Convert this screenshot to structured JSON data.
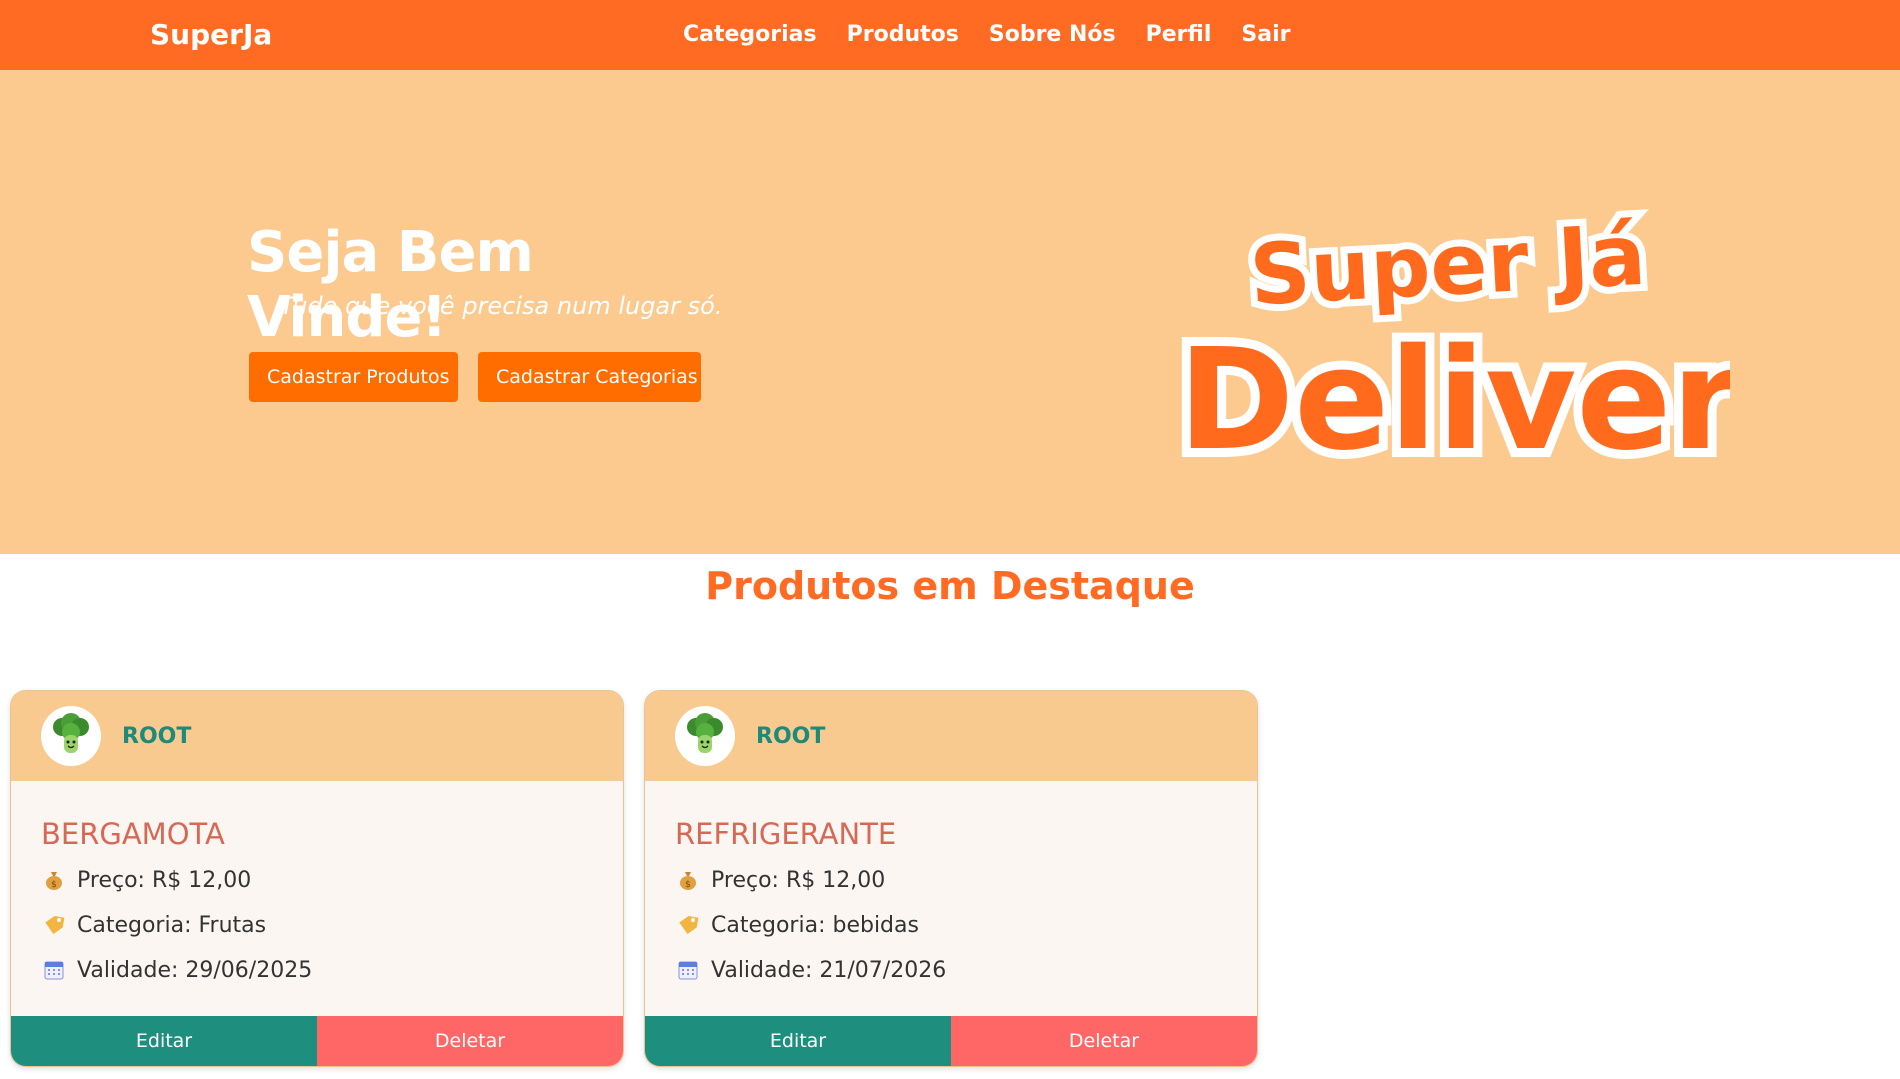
{
  "navbar": {
    "brand": "SuperJa",
    "links": [
      "Categorias",
      "Produtos",
      "Sobre Nós",
      "Perfil",
      "Sair"
    ]
  },
  "hero": {
    "title": "Seja Bem Vinde!",
    "subtitle": "Tudo que você precisa num lugar só.",
    "btn_produtos": "Cadastrar Produtos",
    "btn_categorias": "Cadastrar Categorias",
    "logo_line1": "Super Já",
    "logo_line2": "Delivery"
  },
  "section": {
    "title": "Produtos em Destaque"
  },
  "products": [
    {
      "owner": "ROOT",
      "name": "BERGAMOTA",
      "price": "Preço: R$ 12,00",
      "category": "Categoria: Frutas",
      "validity": "Validade: 29/06/2025",
      "edit_label": "Editar",
      "delete_label": "Deletar"
    },
    {
      "owner": "ROOT",
      "name": "REFRIGERANTE",
      "price": "Preço: R$ 12,00",
      "category": "Categoria: bebidas",
      "validity": "Validade: 21/07/2026",
      "edit_label": "Editar",
      "delete_label": "Deletar"
    }
  ],
  "colors": {
    "primary": "#ff6b22",
    "hero_bg": "#fcca8f",
    "card_header": "#f8ca90",
    "edit": "#1e8f7e",
    "delete": "#ff6666"
  },
  "icons": {
    "price": "money-bag-icon",
    "category": "tag-icon",
    "validity": "calendar-icon",
    "avatar": "broccoli-icon"
  }
}
